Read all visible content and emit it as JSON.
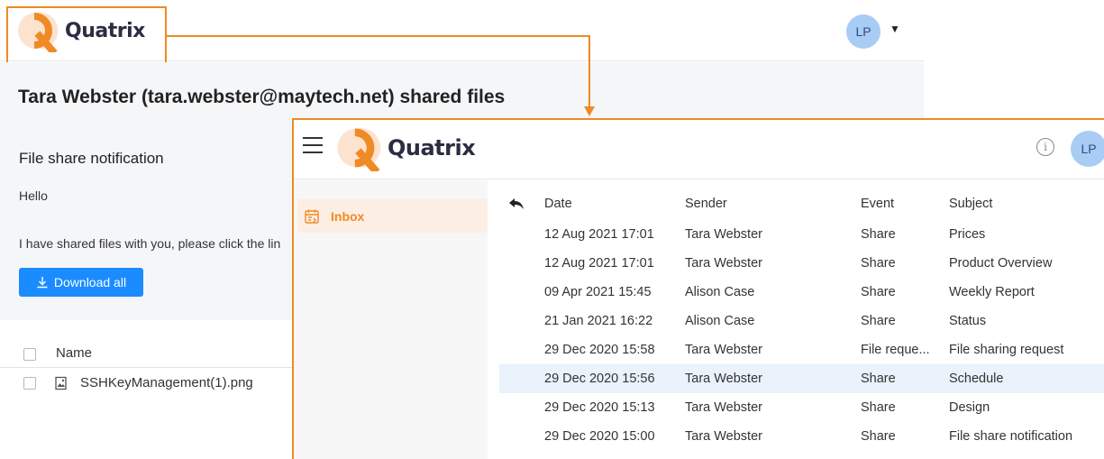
{
  "back_page": {
    "brand": "Quatrix",
    "avatar_initials": "LP",
    "title": "Tara Webster (tara.webster@maytech.net) shared files",
    "notification_title": "File share notification",
    "greeting": "Hello",
    "message": "I have shared files with you, please click the lin",
    "download_all_label": "Download all",
    "files_table": {
      "column_name": "Name",
      "rows": [
        {
          "name": "SSHKeyManagement(1).png"
        }
      ]
    }
  },
  "app_window": {
    "brand": "Quatrix",
    "avatar_initials": "LP",
    "info_glyph": "i",
    "sidebar": {
      "items": [
        {
          "label": "Inbox",
          "icon": "inbox-calendar-icon",
          "active": true
        }
      ]
    },
    "table": {
      "columns": {
        "date": "Date",
        "sender": "Sender",
        "event": "Event",
        "subject": "Subject"
      },
      "rows": [
        {
          "date": "12 Aug 2021 17:01",
          "sender": "Tara Webster",
          "event": "Share",
          "subject": "Prices"
        },
        {
          "date": "12 Aug 2021 17:01",
          "sender": "Tara Webster",
          "event": "Share",
          "subject": "Product Overview"
        },
        {
          "date": "09 Apr 2021 15:45",
          "sender": "Alison Case",
          "event": "Share",
          "subject": "Weekly Report"
        },
        {
          "date": "21 Jan 2021 16:22",
          "sender": "Alison Case",
          "event": "Share",
          "subject": "Status"
        },
        {
          "date": "29 Dec 2020 15:58",
          "sender": "Tara Webster",
          "event": "File reque...",
          "subject": "File sharing request"
        },
        {
          "date": "29 Dec 2020 15:56",
          "sender": "Tara Webster",
          "event": "Share",
          "subject": "Schedule",
          "selected": true
        },
        {
          "date": "29 Dec 2020 15:13",
          "sender": "Tara Webster",
          "event": "Share",
          "subject": "Design"
        },
        {
          "date": "29 Dec 2020 15:00",
          "sender": "Tara Webster",
          "event": "Share",
          "subject": "File share notification"
        }
      ]
    }
  },
  "colors": {
    "accent_orange": "#f08a24",
    "button_blue": "#1a8cff",
    "avatar_blue": "#a9ccf5",
    "selected_row": "#eaf2fb"
  }
}
